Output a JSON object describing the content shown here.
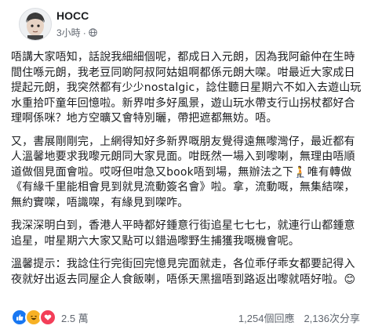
{
  "post": {
    "author": "HOCC",
    "time": "3小時",
    "paragraphs": [
      "唔講大家唔知，話說我細細個呢，都成日入元朗，因為我阿爺仲在生時間住喺元朗，我老豆同啲阿叔阿姑姐啊都係元朗大㗎。咁最近大家成日提起元朗，我突然都有少少nostalgic，諗住聽日星期六不如入去遊山玩水重拾吓童年回憶啦。新界咁多好風景，遊山玩水帶支行山拐杖都好合理啊係咪？地方空曠又會特別曬，帶把遮都無妨。唔。",
      "又，書展剛剛完，上網得知好多新界嘅朋友覺得遠無嚟灣仔，最近都有人溫馨地要求我嚟元朗同大家見面。咁既然一場入到嚟喇，無理由唔順道做個見面會啦。哎呀但咁急又book唔到場，無辦法之下🧎唯有轉做《有緣千里能相會見到就見流動簽名會》啦。拿，流動嘅，無集結㗎，無約實㗎，唔識㗎，有緣見到㗎咋。",
      "我深深明白到，香港人平時都好鍾意行街追星七七七，就連行山都鍾意追星，咁星期六大家又點可以錯過嚟野生捕獲我嘅機會呢。",
      "溫馨提示：我諗住行完街回完憶見完面就走，各位乖仔乖女都要記得入夜就好出返去同屋企人食飯喇，唔係天黑搵唔到路返出嚟就唔好啦。😊"
    ]
  },
  "footer": {
    "reaction_count": "2.5 萬",
    "comments": "1,254個回應",
    "shares": "2,136次分享"
  },
  "icons": {
    "globe": "globe-icon",
    "like": "like-reaction-icon",
    "haha": "haha-reaction-icon",
    "love": "love-reaction-icon"
  },
  "colors": {
    "like": "#1877f2",
    "haha": "#f7b125",
    "love": "#f33e58",
    "meta": "#616770"
  }
}
